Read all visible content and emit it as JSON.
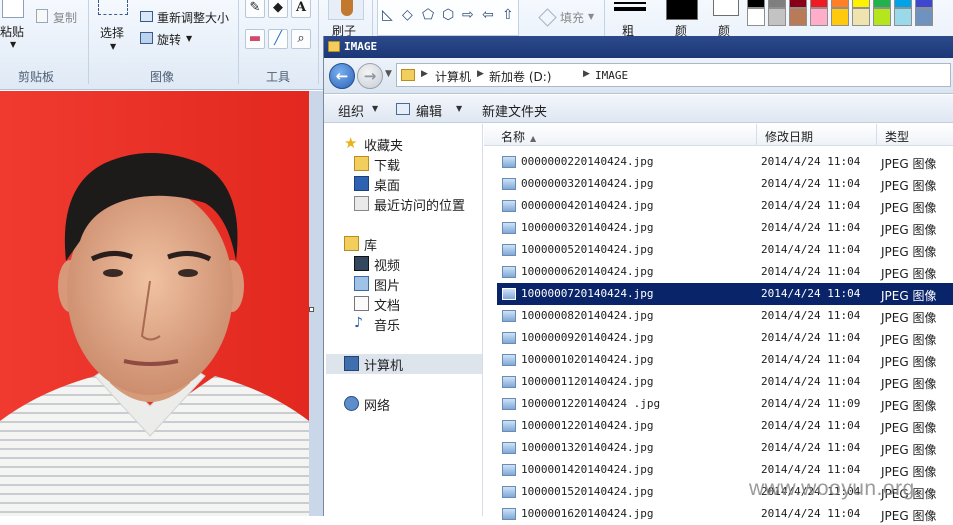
{
  "ribbon": {
    "clipboard": {
      "paste_label": "粘贴",
      "copy_label": "复制",
      "group_label": "剪贴板"
    },
    "image": {
      "select_label": "选择",
      "resize_label": "重新调整大小",
      "rotate_label": "旋转",
      "group_label": "图像"
    },
    "tools": {
      "group_label": "工具",
      "text_tool": "A"
    },
    "brush_label": "刷子",
    "fill_label": "填充",
    "size_label": "粗",
    "color1_label": "颜",
    "color2_label": "颜",
    "colors": {
      "color1": "#000000",
      "color2": "#ffffff",
      "palette_row1": [
        "#000000",
        "#7f7f7f",
        "#880015",
        "#ed1c24",
        "#ff7f27",
        "#fff200",
        "#22b14c",
        "#00a2e8",
        "#3f48cc",
        "#a349a4"
      ],
      "palette_row2": [
        "#ffffff",
        "#c3c3c3",
        "#b97a57",
        "#ffaec9",
        "#ffc90e",
        "#efe4b0",
        "#b5e61d",
        "#99d9ea",
        "#7092be",
        "#c8bfe7"
      ]
    }
  },
  "explorer": {
    "title": "IMAGE",
    "breadcrumb": [
      "计算机",
      "新加卷 (D:)",
      "IMAGE"
    ],
    "toolbar": {
      "organize": "组织",
      "edit": "编辑",
      "new_folder": "新建文件夹"
    },
    "nav": {
      "favorites": "收藏夹",
      "downloads": "下载",
      "desktop": "桌面",
      "recent": "最近访问的位置",
      "libraries": "库",
      "videos": "视频",
      "pictures": "图片",
      "documents": "文档",
      "music": "音乐",
      "computer": "计算机",
      "network": "网络"
    },
    "columns": {
      "name": "名称",
      "date": "修改日期",
      "type": "类型"
    },
    "files": [
      {
        "name": "0000000220140424.jpg",
        "date": "2014/4/24 11:04",
        "type": "JPEG 图像",
        "selected": false
      },
      {
        "name": "0000000320140424.jpg",
        "date": "2014/4/24 11:04",
        "type": "JPEG 图像",
        "selected": false
      },
      {
        "name": "0000000420140424.jpg",
        "date": "2014/4/24 11:04",
        "type": "JPEG 图像",
        "selected": false
      },
      {
        "name": "1000000320140424.jpg",
        "date": "2014/4/24 11:04",
        "type": "JPEG 图像",
        "selected": false
      },
      {
        "name": "1000000520140424.jpg",
        "date": "2014/4/24 11:04",
        "type": "JPEG 图像",
        "selected": false
      },
      {
        "name": "1000000620140424.jpg",
        "date": "2014/4/24 11:04",
        "type": "JPEG 图像",
        "selected": false
      },
      {
        "name": "1000000720140424.jpg",
        "date": "2014/4/24 11:04",
        "type": "JPEG 图像",
        "selected": true
      },
      {
        "name": "1000000820140424.jpg",
        "date": "2014/4/24 11:04",
        "type": "JPEG 图像",
        "selected": false
      },
      {
        "name": "1000000920140424.jpg",
        "date": "2014/4/24 11:04",
        "type": "JPEG 图像",
        "selected": false
      },
      {
        "name": "1000001020140424.jpg",
        "date": "2014/4/24 11:04",
        "type": "JPEG 图像",
        "selected": false
      },
      {
        "name": "1000001120140424.jpg",
        "date": "2014/4/24 11:04",
        "type": "JPEG 图像",
        "selected": false
      },
      {
        "name": "1000001220140424 .jpg",
        "date": "2014/4/24 11:09",
        "type": "JPEG 图像",
        "selected": false
      },
      {
        "name": "1000001220140424.jpg",
        "date": "2014/4/24 11:04",
        "type": "JPEG 图像",
        "selected": false
      },
      {
        "name": "1000001320140424.jpg",
        "date": "2014/4/24 11:04",
        "type": "JPEG 图像",
        "selected": false
      },
      {
        "name": "1000001420140424.jpg",
        "date": "2014/4/24 11:04",
        "type": "JPEG 图像",
        "selected": false
      },
      {
        "name": "1000001520140424.jpg",
        "date": "2014/4/24 11:04",
        "type": "JPEG 图像",
        "selected": false
      },
      {
        "name": "1000001620140424.jpg",
        "date": "2014/4/24 11:04",
        "type": "JPEG 图像",
        "selected": false
      }
    ]
  },
  "watermark": "www.wooyun.org",
  "theme": {
    "selection": "#0a246a",
    "titlebar": "#1c3775",
    "photo_background": "#e8322c"
  }
}
